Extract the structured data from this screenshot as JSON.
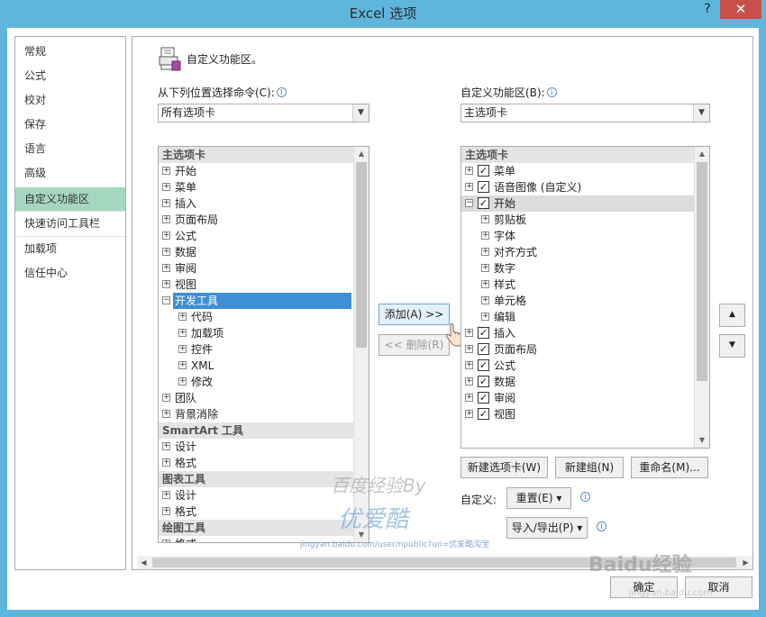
{
  "window": {
    "title": "Excel 选项",
    "help": "?",
    "close": "✕"
  },
  "nav": {
    "items": [
      {
        "label": "常规"
      },
      {
        "label": "公式"
      },
      {
        "label": "校对"
      },
      {
        "label": "保存"
      },
      {
        "label": "语言"
      },
      {
        "label": "高级"
      },
      {
        "label": "自定义功能区",
        "selected": true
      },
      {
        "label": "快速访问工具栏"
      },
      {
        "label": "加载项"
      },
      {
        "label": "信任中心"
      }
    ]
  },
  "header": {
    "title": "自定义功能区。",
    "icon": "customize-ribbon-icon"
  },
  "left": {
    "label": "从下列位置选择命令(C):",
    "combo_value": "所有选项卡",
    "list": [
      {
        "type": "header",
        "label": "主选项卡"
      },
      {
        "level": 0,
        "expander": "+",
        "label": "开始"
      },
      {
        "level": 0,
        "expander": "+",
        "label": "菜单"
      },
      {
        "level": 0,
        "expander": "+",
        "label": "插入"
      },
      {
        "level": 0,
        "expander": "+",
        "label": "页面布局"
      },
      {
        "level": 0,
        "expander": "+",
        "label": "公式"
      },
      {
        "level": 0,
        "expander": "+",
        "label": "数据"
      },
      {
        "level": 0,
        "expander": "+",
        "label": "审阅"
      },
      {
        "level": 0,
        "expander": "+",
        "label": "视图"
      },
      {
        "level": 0,
        "expander": "−",
        "label": "开发工具",
        "highlighted": true
      },
      {
        "level": 1,
        "expander": "+",
        "label": "代码"
      },
      {
        "level": 1,
        "expander": "+",
        "label": "加载项"
      },
      {
        "level": 1,
        "expander": "+",
        "label": "控件"
      },
      {
        "level": 1,
        "expander": "+",
        "label": "XML"
      },
      {
        "level": 1,
        "expander": "+",
        "label": "修改"
      },
      {
        "level": 0,
        "expander": "+",
        "label": "团队"
      },
      {
        "level": 0,
        "expander": "+",
        "label": "背景消除"
      },
      {
        "type": "header",
        "label": "SmartArt 工具"
      },
      {
        "level": 0,
        "expander": "+",
        "label": "设计"
      },
      {
        "level": 0,
        "expander": "+",
        "label": "格式"
      },
      {
        "type": "header",
        "label": "图表工具"
      },
      {
        "level": 0,
        "expander": "+",
        "label": "设计"
      },
      {
        "level": 0,
        "expander": "+",
        "label": "格式"
      },
      {
        "type": "header",
        "label": "绘图工具"
      },
      {
        "level": 0,
        "expander": "+",
        "label": "格式"
      }
    ]
  },
  "middle": {
    "add_label": "添加(A) >>",
    "remove_label": "<< 删除(R)"
  },
  "right": {
    "label": "自定义功能区(B):",
    "combo_value": "主选项卡",
    "list": [
      {
        "type": "header",
        "label": "主选项卡"
      },
      {
        "level": 0,
        "expander": "+",
        "checked": true,
        "label": "菜单"
      },
      {
        "level": 0,
        "expander": "+",
        "checked": true,
        "label": "语音图像 (自定义)"
      },
      {
        "level": 0,
        "expander": "−",
        "checked": true,
        "label": "开始",
        "highlighted": true
      },
      {
        "level": 1,
        "expander": "+",
        "label": "剪贴板"
      },
      {
        "level": 1,
        "expander": "+",
        "label": "字体"
      },
      {
        "level": 1,
        "expander": "+",
        "label": "对齐方式"
      },
      {
        "level": 1,
        "expander": "+",
        "label": "数字"
      },
      {
        "level": 1,
        "expander": "+",
        "label": "样式"
      },
      {
        "level": 1,
        "expander": "+",
        "label": "单元格"
      },
      {
        "level": 1,
        "expander": "+",
        "label": "编辑"
      },
      {
        "level": 0,
        "expander": "+",
        "checked": true,
        "label": "插入"
      },
      {
        "level": 0,
        "expander": "+",
        "checked": true,
        "label": "页面布局"
      },
      {
        "level": 0,
        "expander": "+",
        "checked": true,
        "label": "公式"
      },
      {
        "level": 0,
        "expander": "+",
        "checked": true,
        "label": "数据"
      },
      {
        "level": 0,
        "expander": "+",
        "checked": true,
        "label": "审阅"
      },
      {
        "level": 0,
        "expander": "+",
        "checked": true,
        "label": "视图"
      }
    ],
    "new_tab": "新建选项卡(W)",
    "new_group": "新建组(N)",
    "rename": "重命名(M)...",
    "customize_label": "自定义:",
    "reset": "重置(E) ▾",
    "import_export": "导入/导出(P) ▾"
  },
  "move_up": "▲",
  "move_down": "▼",
  "footer": {
    "ok": "确定",
    "cancel": "取消"
  },
  "watermark": {
    "line1": "百度经验By",
    "line2": "优爱酷",
    "url": "jingyan.baidu.com/user/npublic?un=优爱酷淘宝",
    "brand": "Baidu经验",
    "brand_url": "jingyan.baidu.com"
  },
  "colors": {
    "titlebar": "#5fb6dc",
    "nav_selected": "#a5d7bf",
    "list_highlight": "#3f8fd6",
    "close": "#c7514a"
  }
}
